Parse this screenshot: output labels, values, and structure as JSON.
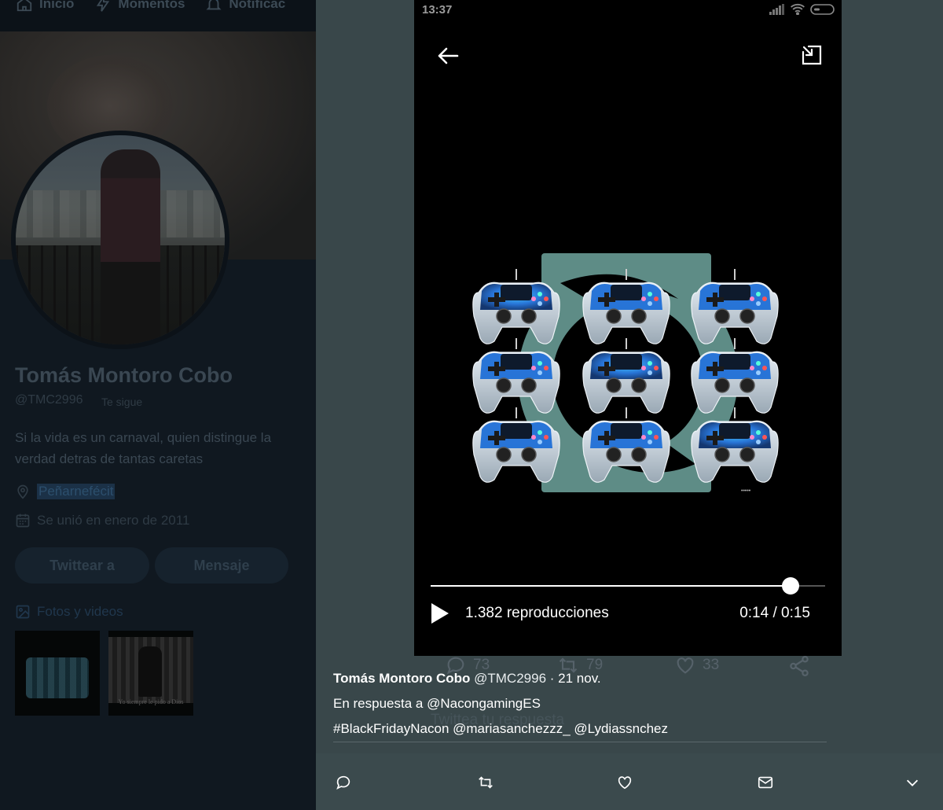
{
  "nav": {
    "items": [
      {
        "label": "Inicio",
        "icon": "home-icon"
      },
      {
        "label": "Momentos",
        "icon": "lightning-icon"
      },
      {
        "label": "Notificac",
        "icon": "bell-icon"
      }
    ]
  },
  "profile": {
    "name": "Tomás Montoro Cobo",
    "handle": "@TMC2996",
    "follows_you": "Te sigue",
    "bio": "Si la vida es un carnaval, quien distingue la verdad detras de tantas caretas",
    "location": "Peñarnefécit",
    "joined": "Se unió en enero de 2011",
    "tweet_button": "Twittear a",
    "message_button": "Mensaje",
    "media_label": "Fotos y videos",
    "thumb2_caption": "Yo siempre le pido a Dios"
  },
  "player": {
    "status_time": "13:37",
    "views": "1.382 reproducciones",
    "time": "0:14 / 0:15",
    "progress_fraction": 0.912
  },
  "tweet": {
    "author_name": "Tomás Montoro Cobo",
    "author_handle": "@TMC2996",
    "date": "· 21 nov.",
    "reply_to": "En respuesta a @NacongamingES",
    "body": "#BlackFridayNacon @mariasanchezzz_  @Lydiassnchez",
    "ghost_counts": {
      "replies": "73",
      "retweets": "79",
      "likes": "33"
    },
    "ghost_reply_placeholder": "Twittea tu respuesta"
  },
  "colors": {
    "modal_bg": "#39474a",
    "controller_blue": "#1f6fd6",
    "controller_glow": "#3cc8ff",
    "logo_teal": "#5e8c86"
  }
}
